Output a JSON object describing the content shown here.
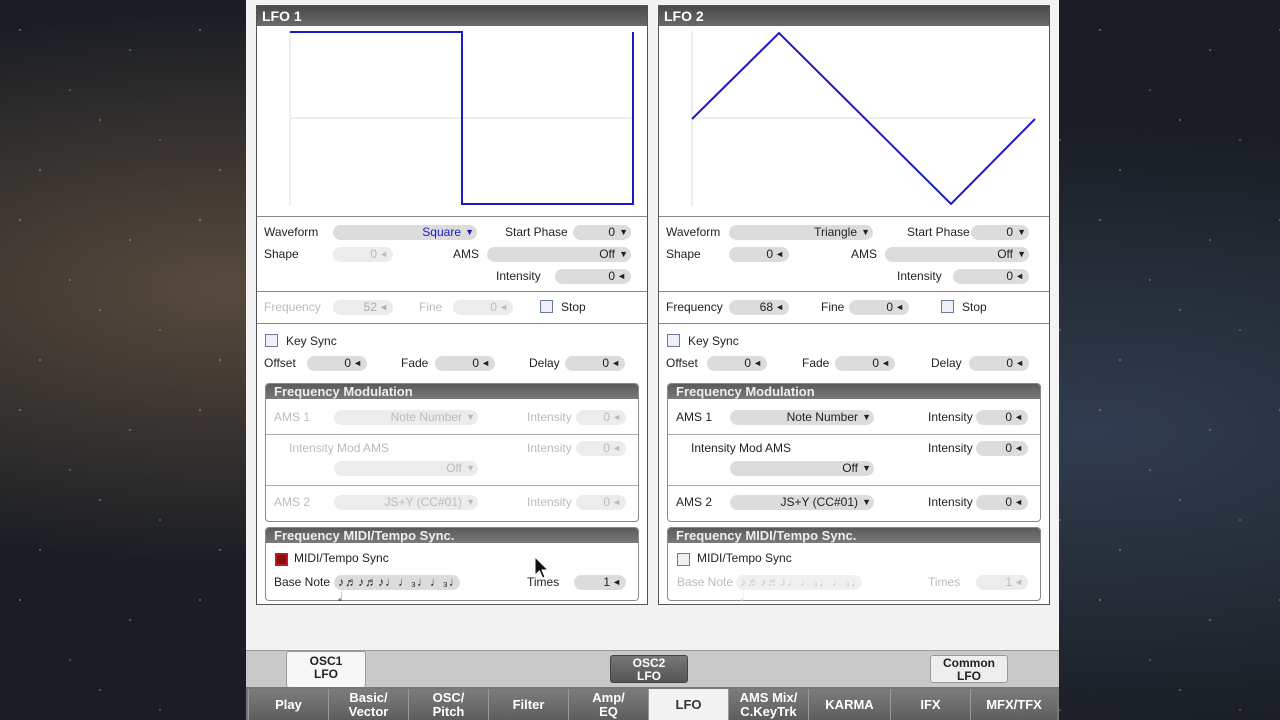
{
  "lfo1": {
    "title": "LFO 1",
    "waveform_label": "Waveform",
    "waveform_value": "Square",
    "start_phase_label": "Start Phase",
    "start_phase_value": "0",
    "shape_label": "Shape",
    "shape_value": "0",
    "ams_label": "AMS",
    "ams_value": "Off",
    "intensity_label": "Intensity",
    "intensity_value": "0",
    "frequency_label": "Frequency",
    "frequency_value": "52",
    "fine_label": "Fine",
    "fine_value": "0",
    "stop_label": "Stop",
    "key_sync_label": "Key Sync",
    "offset_label": "Offset",
    "offset_value": "0",
    "fade_label": "Fade",
    "fade_value": "0",
    "delay_label": "Delay",
    "delay_value": "0",
    "fm": {
      "title": "Frequency Modulation",
      "ams1_label": "AMS 1",
      "ams1_value": "Note Number",
      "intensity1_label": "Intensity",
      "intensity1_value": "0",
      "imod_label": "Intensity Mod AMS",
      "imod_value": "Off",
      "intensity2_label": "Intensity",
      "intensity2_value": "0",
      "ams2_label": "AMS 2",
      "ams2_value": "JS+Y  (CC#01)",
      "intensity3_label": "Intensity",
      "intensity3_value": "0"
    },
    "sync": {
      "title": "Frequency MIDI/Tempo Sync.",
      "midi_label": "MIDI/Tempo Sync",
      "base_note_label": "Base Note",
      "base_note_value": "♪♬♪♬♪♩♩₃♩♩₃♩ 𝅗𝅥",
      "times_label": "Times",
      "times_value": "1"
    }
  },
  "lfo2": {
    "title": "LFO 2",
    "waveform_label": "Waveform",
    "waveform_value": "Triangle",
    "start_phase_label": "Start Phase",
    "start_phase_value": "0",
    "shape_label": "Shape",
    "shape_value": "0",
    "ams_label": "AMS",
    "ams_value": "Off",
    "intensity_label": "Intensity",
    "intensity_value": "0",
    "frequency_label": "Frequency",
    "frequency_value": "68",
    "fine_label": "Fine",
    "fine_value": "0",
    "stop_label": "Stop",
    "key_sync_label": "Key Sync",
    "offset_label": "Offset",
    "offset_value": "0",
    "fade_label": "Fade",
    "fade_value": "0",
    "delay_label": "Delay",
    "delay_value": "0",
    "fm": {
      "title": "Frequency Modulation",
      "ams1_label": "AMS 1",
      "ams1_value": "Note Number",
      "intensity1_label": "Intensity",
      "intensity1_value": "0",
      "imod_label": "Intensity Mod AMS",
      "imod_value": "Off",
      "intensity2_label": "Intensity",
      "intensity2_value": "0",
      "ams2_label": "AMS 2",
      "ams2_value": "JS+Y  (CC#01)",
      "intensity3_label": "Intensity",
      "intensity3_value": "0"
    },
    "sync": {
      "title": "Frequency MIDI/Tempo Sync.",
      "midi_label": "MIDI/Tempo Sync",
      "base_note_label": "Base Note",
      "base_note_value": "♪♬♪♬♪♩♩₃♩♩₃♩ 𝅗𝅥",
      "times_label": "Times",
      "times_value": "1"
    }
  },
  "subtabs": {
    "osc1": "OSC1\nLFO",
    "osc2": "OSC2\nLFO",
    "common": "Common\nLFO"
  },
  "tabs": [
    "Play",
    "Basic/\nVector",
    "OSC/\nPitch",
    "Filter",
    "Amp/\nEQ",
    "LFO",
    "AMS Mix/\nC.KeyTrk",
    "KARMA",
    "IFX",
    "MFX/TFX"
  ],
  "colors": {
    "wave": "#1a1ac8",
    "panel": "#f3f3f3",
    "active_check": "#8a1010"
  }
}
